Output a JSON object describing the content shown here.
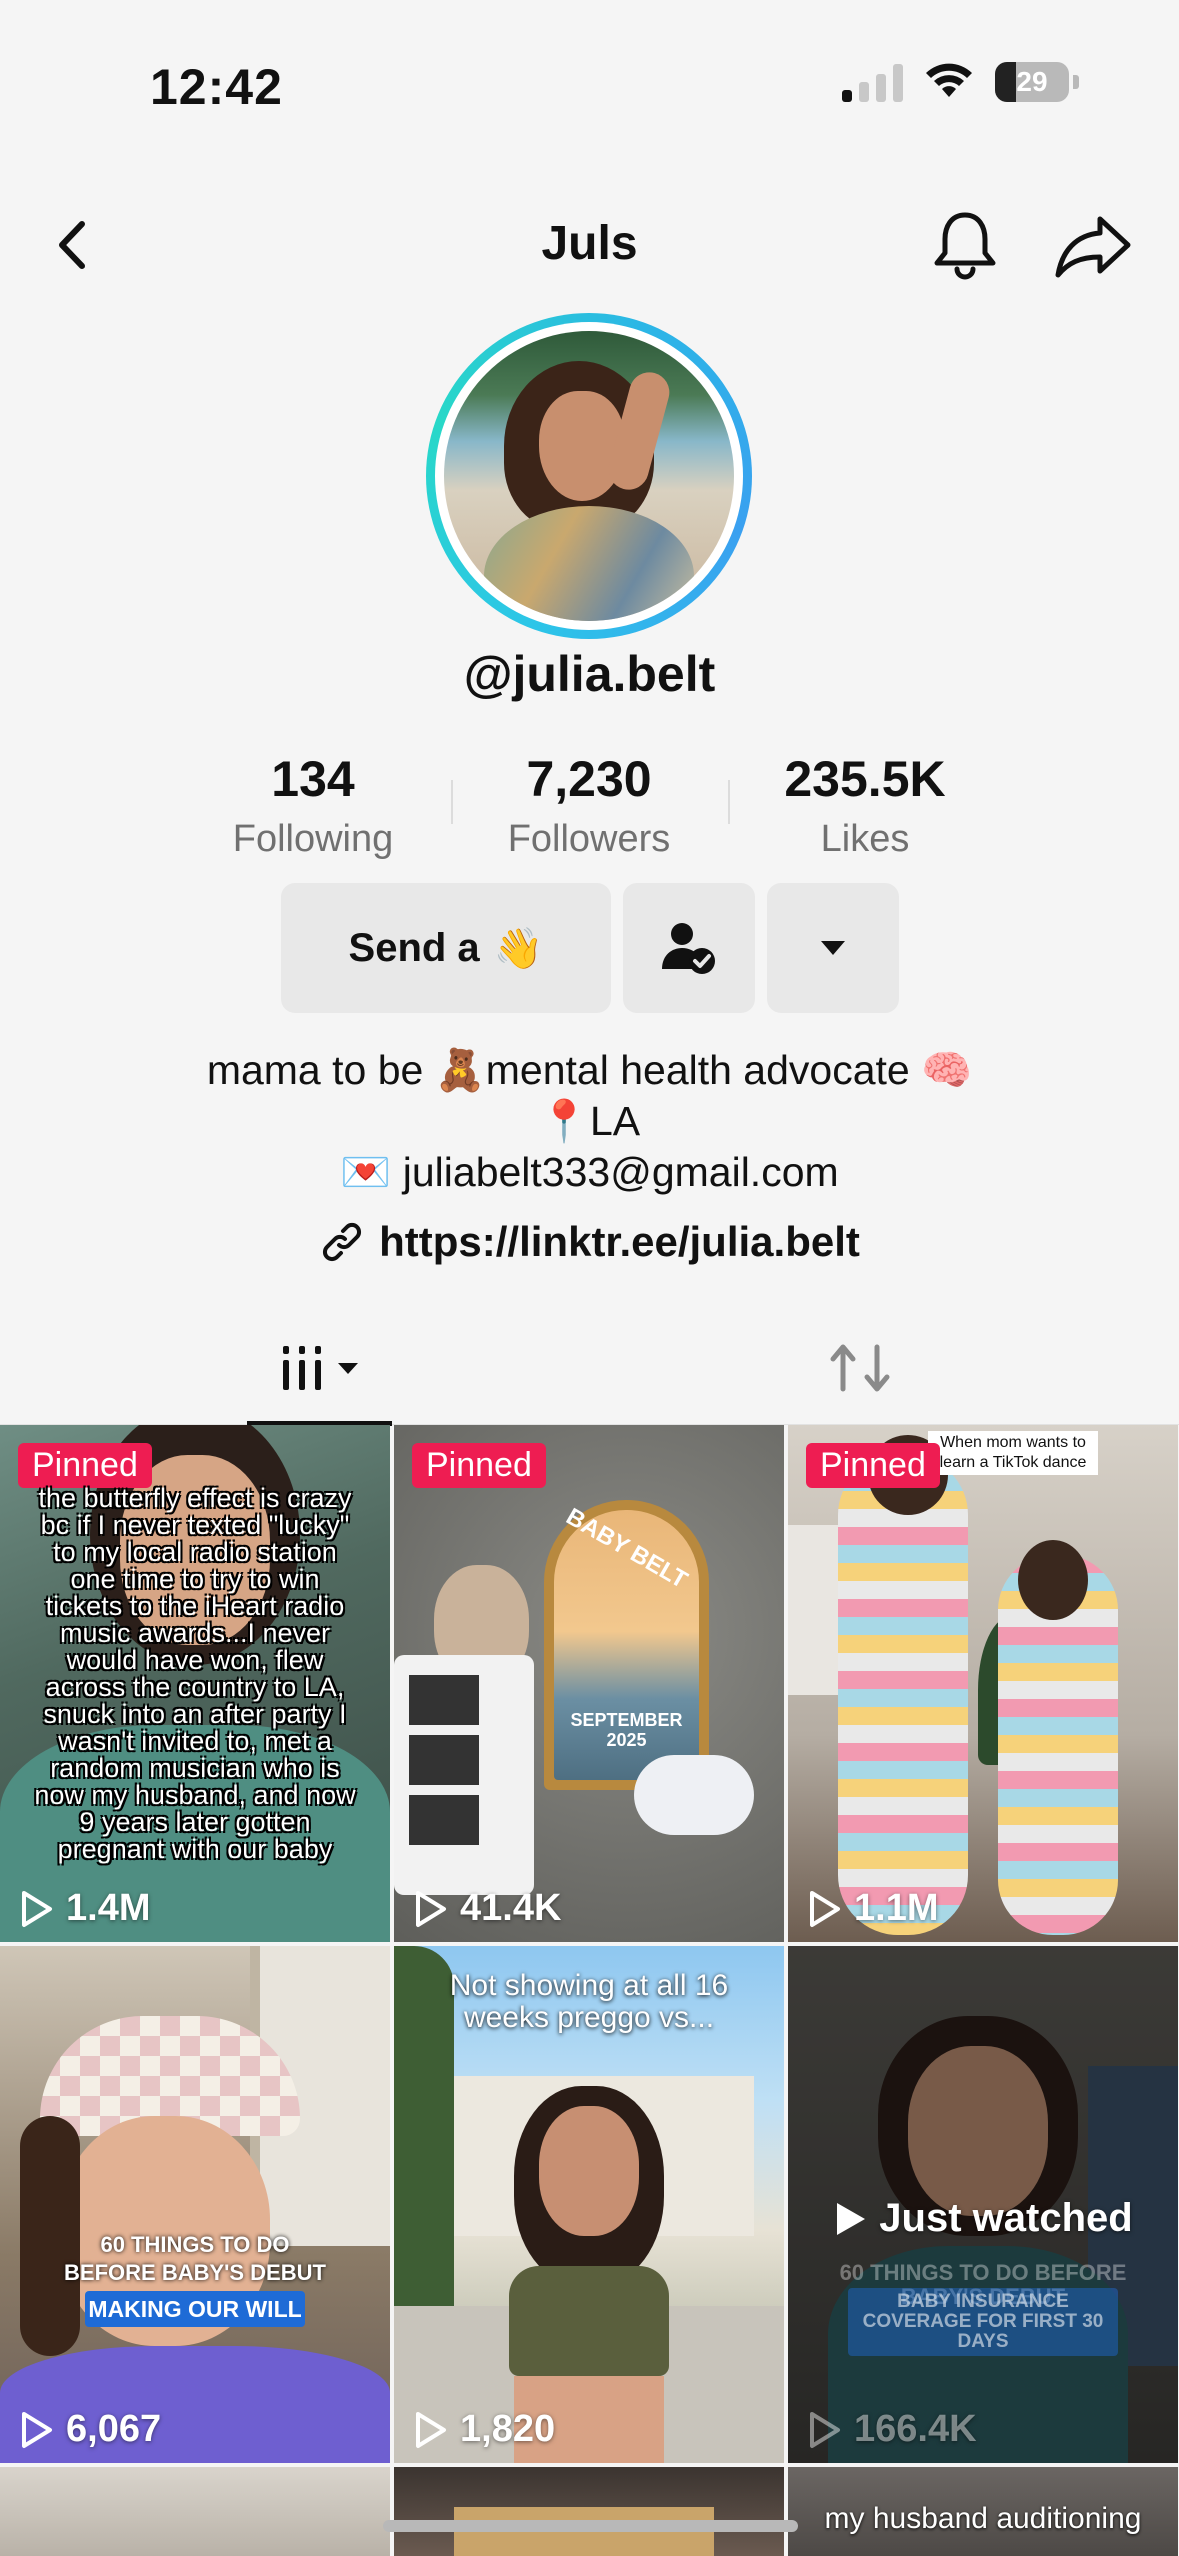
{
  "status": {
    "time": "12:42",
    "battery": "29"
  },
  "nav": {
    "title": "Juls"
  },
  "profile": {
    "username": "@julia.belt",
    "stats": [
      {
        "value": "134",
        "label": "Following"
      },
      {
        "value": "7,230",
        "label": "Followers"
      },
      {
        "value": "235.5K",
        "label": "Likes"
      }
    ],
    "send_label": "Send a",
    "send_emoji": "👋",
    "bio": [
      "mama to be 🧸mental health advocate 🧠",
      "📍LA",
      "💌 juliabelt333@gmail.com"
    ],
    "link": "https://linktr.ee/julia.belt"
  },
  "videos": [
    {
      "pinned": "Pinned",
      "views": "1.4M",
      "caption": "the butterfly effect is crazy bc if I never texted \"lucky\" to my local radio station one time to try to win tickets to the iHeart radio music awards...I never would have won, flew across the country to LA, snuck into an after party I wasn't invited to, met a random musician who is now my husband, and now 9 years later gotten pregnant with our baby"
    },
    {
      "pinned": "Pinned",
      "views": "41.4K",
      "sign_top": "BABY BELT",
      "sign_bottom": "SEPTEMBER 2025"
    },
    {
      "pinned": "Pinned",
      "views": "1.1M",
      "caption": "When mom wants to learn a TikTok dance"
    },
    {
      "views": "6,067",
      "overlay": "60 THINGS TO DO BEFORE BABY'S DEBUT",
      "tag": "MAKING OUR WILL"
    },
    {
      "views": "1,820",
      "caption": "Not showing at all 16 weeks preggo vs..."
    },
    {
      "views": "166.4K",
      "watched": "Just watched",
      "overlay": "60 THINGS TO DO BEFORE BABY'S DEBUT",
      "tag": "BABY INSURANCE COVERAGE FOR FIRST 30 DAYS"
    },
    {
      "caption": "my husband auditioning"
    }
  ],
  "colors": {
    "accent": "#ee1d52",
    "ring": "#2cc5e8"
  }
}
